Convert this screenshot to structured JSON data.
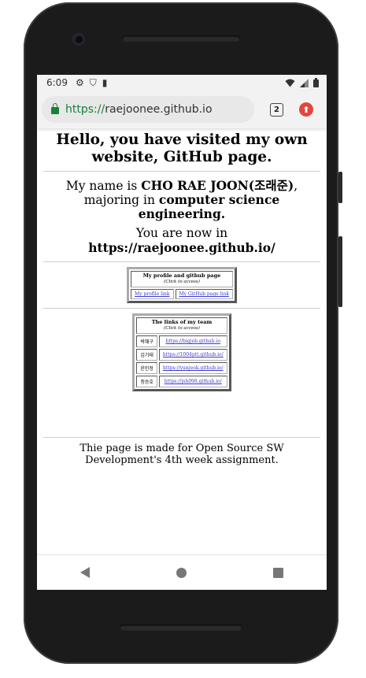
{
  "status_bar": {
    "time": "6:09",
    "icons": [
      "gear-icon",
      "shield-icon",
      "sim-card-icon",
      "wifi-icon",
      "signal-icon",
      "battery-icon"
    ]
  },
  "browser": {
    "url_scheme": "https://",
    "url_host": "raejoonee.github.io",
    "tab_count": "2"
  },
  "page": {
    "heading": "Hello, you have visited my own website, GitHub page.",
    "intro_prefix": "My name is ",
    "intro_name": "CHO RAE JOON(조래준)",
    "intro_mid": ", majoring in ",
    "intro_major": "computer science engineering.",
    "now_prefix": "You are now in ",
    "now_url": "https://raejoonee.github.io/",
    "profile_table": {
      "title": "My profile and github page",
      "hint": "(Click to access)",
      "links": [
        "My profile link",
        "My GitHub page link"
      ]
    },
    "team_table": {
      "title": "The links of my team",
      "hint": "(Click to access)",
      "rows": [
        {
          "name": "박혜구",
          "link": "https://bigjeb.github.io"
        },
        {
          "name": "김기태",
          "link": "https://1004ptt.github.io/"
        },
        {
          "name": "윤민정",
          "link": "https://yunjeok.github.io/"
        },
        {
          "name": "정승호",
          "link": "https://jsh098.github.io/"
        }
      ]
    },
    "footer": "Thie page is made for Open Source SW Development's 4th week assignment."
  }
}
